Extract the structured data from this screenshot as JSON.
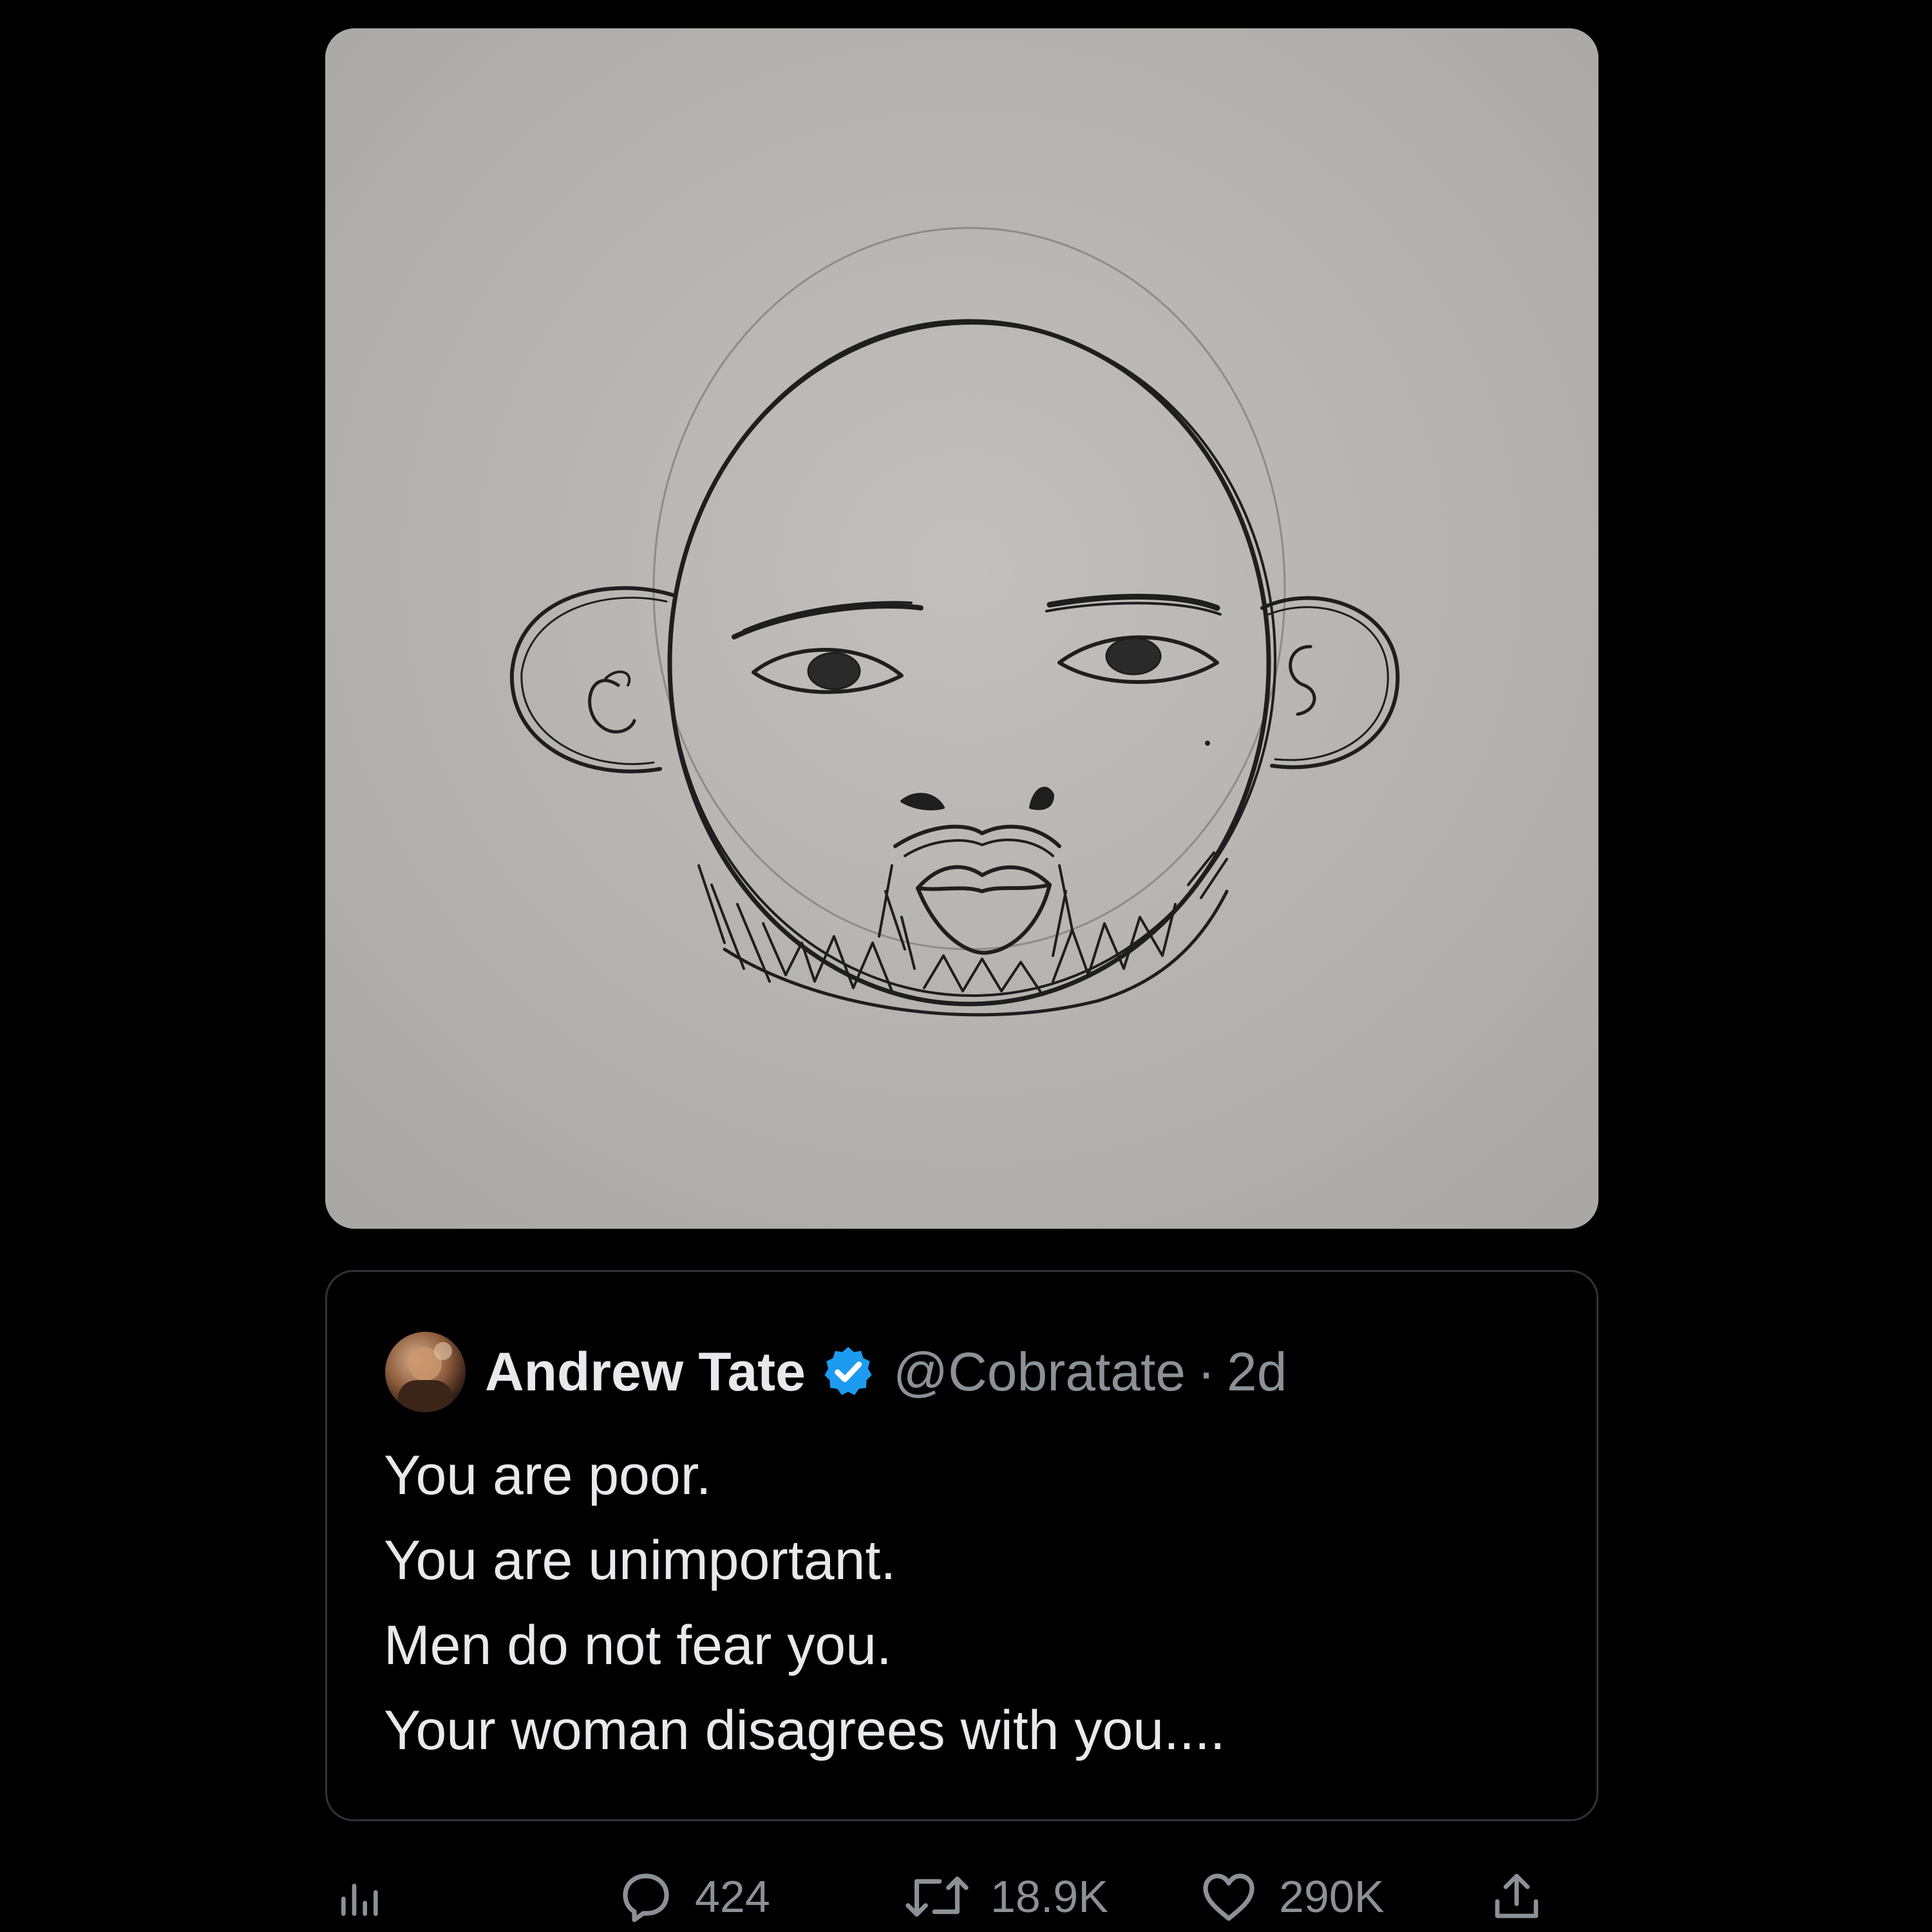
{
  "media": {
    "description_icon": "pencil-sketch-face-icon"
  },
  "quote": {
    "author_name": "Andrew Tate",
    "verified_icon": "verified-badge-icon",
    "verified_color": "#1d9bf0",
    "handle": "@Cobratate",
    "separator": "·",
    "time": "2d",
    "lines": [
      "You are poor.",
      "You are unimportant.",
      "Men do not fear you.",
      "Your woman disagrees with you...."
    ]
  },
  "actions": {
    "analytics_icon": "analytics-icon",
    "reply": {
      "icon": "reply-icon",
      "count": "424"
    },
    "retweet": {
      "icon": "retweet-icon",
      "count": "18.9K"
    },
    "like": {
      "icon": "heart-icon",
      "count": "290K"
    },
    "share_icon": "share-icon"
  },
  "colors": {
    "background": "#000000",
    "text": "#e7e9ea",
    "muted": "#8b9196",
    "paper": "#b6b4b1"
  }
}
